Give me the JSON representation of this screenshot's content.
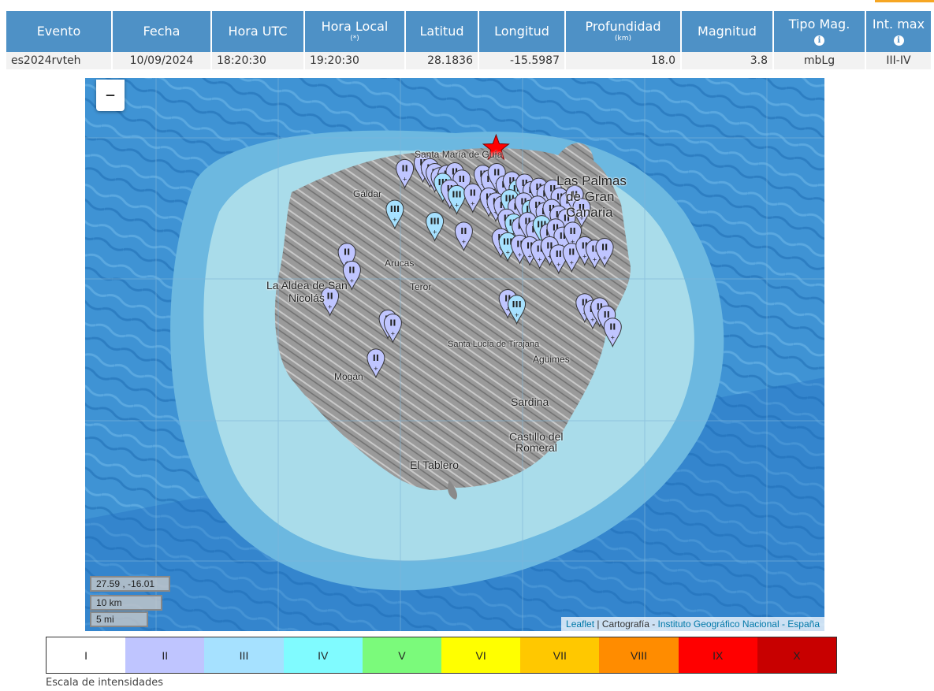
{
  "table": {
    "headers": {
      "evento": "Evento",
      "fecha": "Fecha",
      "hora_utc": "Hora UTC",
      "hora_local": "Hora Local",
      "hora_local_sub": "(*)",
      "latitud": "Latitud",
      "longitud": "Longitud",
      "profundidad": "Profundidad",
      "profundidad_sub": "(km)",
      "magnitud": "Magnitud",
      "tipo_mag": "Tipo Mag.",
      "int_max": "Int. max",
      "info_icon": "i"
    },
    "row": {
      "evento": "es2024rvteh",
      "fecha": "10/09/2024",
      "hora_utc": "18:20:30",
      "hora_local": "19:20:30",
      "latitud": "28.1836",
      "longitud": "-15.5987",
      "profundidad": "18.0",
      "magnitud": "3.8",
      "tipo_mag": "mbLg",
      "int_max": "III-IV"
    }
  },
  "map": {
    "zoom_out_label": "–",
    "places": {
      "las_palmas_1": "Las Palmas",
      "las_palmas_2": "de Gran",
      "las_palmas_3": "Canaria",
      "aldea_1": "La Aldea de San",
      "aldea_2": "Nicolás",
      "sardina": "Sardina",
      "castillo_1": "Castillo del",
      "castillo_2": "Romeral",
      "tablero": "El Tablero",
      "mogan": "Mogán",
      "aguimes": "Agüimes",
      "santa_lucia": "Santa Lucía de Tirajana",
      "arucas": "Arucas",
      "teror": "Teror",
      "galdar": "Gáldar",
      "guia": "Santa María de Guía"
    },
    "coords_readout": "27.59 , -16.01",
    "scale_km": "10 km",
    "scale_mi": "5 mi",
    "attribution": {
      "leaflet": "Leaflet",
      "sep1": " | Cartografía - ",
      "ign": "Instituto Geográfico Nacional",
      "sep2": " - ",
      "espana": "España"
    },
    "epicenter_icon": "star-icon",
    "marker_icon": "map-pin-icon",
    "colors": {
      "ocean": "#3f93d4",
      "shelf": "#a9dcea",
      "intensity_II": "#bfc5ff",
      "intensity_III": "#a6e1ff",
      "epicenter": "#ff0000"
    },
    "markers": [
      {
        "lon": -15.69,
        "lat": 28.135,
        "i": "II"
      },
      {
        "lon": -15.672,
        "lat": 28.142,
        "i": "II"
      },
      {
        "lon": -15.665,
        "lat": 28.136,
        "i": "II"
      },
      {
        "lon": -15.66,
        "lat": 28.13,
        "i": "II"
      },
      {
        "lon": -15.655,
        "lat": 28.125,
        "i": "II"
      },
      {
        "lon": -15.648,
        "lat": 28.128,
        "i": "II"
      },
      {
        "lon": -15.64,
        "lat": 28.131,
        "i": "II"
      },
      {
        "lon": -15.633,
        "lat": 28.122,
        "i": "II"
      },
      {
        "lon": -15.652,
        "lat": 28.118,
        "i": "III"
      },
      {
        "lon": -15.645,
        "lat": 28.11,
        "i": "II"
      },
      {
        "lon": -15.638,
        "lat": 28.103,
        "i": "III"
      },
      {
        "lon": -15.622,
        "lat": 28.105,
        "i": "II"
      },
      {
        "lon": -15.612,
        "lat": 28.128,
        "i": "II"
      },
      {
        "lon": -15.605,
        "lat": 28.122,
        "i": "II"
      },
      {
        "lon": -15.598,
        "lat": 28.13,
        "i": "II"
      },
      {
        "lon": -15.59,
        "lat": 28.115,
        "i": "II"
      },
      {
        "lon": -15.583,
        "lat": 28.12,
        "i": "II"
      },
      {
        "lon": -15.577,
        "lat": 28.11,
        "i": "III"
      },
      {
        "lon": -15.57,
        "lat": 28.117,
        "i": "II"
      },
      {
        "lon": -15.563,
        "lat": 28.108,
        "i": "II"
      },
      {
        "lon": -15.556,
        "lat": 28.112,
        "i": "II"
      },
      {
        "lon": -15.549,
        "lat": 28.104,
        "i": "II"
      },
      {
        "lon": -15.542,
        "lat": 28.11,
        "i": "II"
      },
      {
        "lon": -15.535,
        "lat": 28.1,
        "i": "II"
      },
      {
        "lon": -15.526,
        "lat": 28.095,
        "i": "II"
      },
      {
        "lon": -15.52,
        "lat": 28.103,
        "i": "II"
      },
      {
        "lon": -15.513,
        "lat": 28.087,
        "i": "II"
      },
      {
        "lon": -15.606,
        "lat": 28.1,
        "i": "II"
      },
      {
        "lon": -15.599,
        "lat": 28.094,
        "i": "II"
      },
      {
        "lon": -15.592,
        "lat": 28.09,
        "i": "II"
      },
      {
        "lon": -15.585,
        "lat": 28.098,
        "i": "III"
      },
      {
        "lon": -15.578,
        "lat": 28.088,
        "i": "II"
      },
      {
        "lon": -15.571,
        "lat": 28.094,
        "i": "II"
      },
      {
        "lon": -15.564,
        "lat": 28.085,
        "i": "III"
      },
      {
        "lon": -15.557,
        "lat": 28.09,
        "i": "II"
      },
      {
        "lon": -15.55,
        "lat": 28.082,
        "i": "II"
      },
      {
        "lon": -15.543,
        "lat": 28.086,
        "i": "II"
      },
      {
        "lon": -15.536,
        "lat": 28.078,
        "i": "II"
      },
      {
        "lon": -15.528,
        "lat": 28.074,
        "i": "II"
      },
      {
        "lon": -15.588,
        "lat": 28.074,
        "i": "II"
      },
      {
        "lon": -15.581,
        "lat": 28.068,
        "i": "III"
      },
      {
        "lon": -15.574,
        "lat": 28.064,
        "i": "II"
      },
      {
        "lon": -15.567,
        "lat": 28.07,
        "i": "II"
      },
      {
        "lon": -15.56,
        "lat": 28.06,
        "i": "II"
      },
      {
        "lon": -15.553,
        "lat": 28.066,
        "i": "III"
      },
      {
        "lon": -15.546,
        "lat": 28.056,
        "i": "II"
      },
      {
        "lon": -15.539,
        "lat": 28.062,
        "i": "II"
      },
      {
        "lon": -15.532,
        "lat": 28.052,
        "i": "II"
      },
      {
        "lon": -15.522,
        "lat": 28.058,
        "i": "II"
      },
      {
        "lon": -15.7,
        "lat": 28.085,
        "i": "III"
      },
      {
        "lon": -15.66,
        "lat": 28.07,
        "i": "III"
      },
      {
        "lon": -15.631,
        "lat": 28.058,
        "i": "II"
      },
      {
        "lon": -15.594,
        "lat": 28.05,
        "i": "II"
      },
      {
        "lon": -15.587,
        "lat": 28.045,
        "i": "III"
      },
      {
        "lon": -15.575,
        "lat": 28.042,
        "i": "II"
      },
      {
        "lon": -15.565,
        "lat": 28.04,
        "i": "II"
      },
      {
        "lon": -15.555,
        "lat": 28.036,
        "i": "II"
      },
      {
        "lon": -15.545,
        "lat": 28.04,
        "i": "II"
      },
      {
        "lon": -15.536,
        "lat": 28.03,
        "i": "II"
      },
      {
        "lon": -15.523,
        "lat": 28.032,
        "i": "II"
      },
      {
        "lon": -15.51,
        "lat": 28.04,
        "i": "II"
      },
      {
        "lon": -15.5,
        "lat": 28.036,
        "i": "II"
      },
      {
        "lon": -15.49,
        "lat": 28.038,
        "i": "II"
      },
      {
        "lon": -15.748,
        "lat": 28.032,
        "i": "II"
      },
      {
        "lon": -15.743,
        "lat": 28.01,
        "i": "II"
      },
      {
        "lon": -15.765,
        "lat": 27.978,
        "i": "II"
      },
      {
        "lon": -15.707,
        "lat": 27.95,
        "i": "II"
      },
      {
        "lon": -15.702,
        "lat": 27.945,
        "i": "II"
      },
      {
        "lon": -15.719,
        "lat": 27.902,
        "i": "II"
      },
      {
        "lon": -15.587,
        "lat": 27.975,
        "i": "II"
      },
      {
        "lon": -15.578,
        "lat": 27.968,
        "i": "III"
      },
      {
        "lon": -15.51,
        "lat": 27.97,
        "i": "II"
      },
      {
        "lon": -15.502,
        "lat": 27.962,
        "i": "II"
      },
      {
        "lon": -15.495,
        "lat": 27.965,
        "i": "II"
      },
      {
        "lon": -15.488,
        "lat": 27.955,
        "i": "II"
      },
      {
        "lon": -15.482,
        "lat": 27.94,
        "i": "II"
      }
    ],
    "epicenter": {
      "lon": -15.5987,
      "lat": 28.1836
    }
  },
  "legend": {
    "items": [
      {
        "label": "I",
        "color": "#ffffff"
      },
      {
        "label": "II",
        "color": "#bfc5ff"
      },
      {
        "label": "III",
        "color": "#a6e1ff"
      },
      {
        "label": "IV",
        "color": "#80fbff"
      },
      {
        "label": "V",
        "color": "#7bfa7b"
      },
      {
        "label": "VI",
        "color": "#ffff00"
      },
      {
        "label": "VII",
        "color": "#ffc800"
      },
      {
        "label": "VIII",
        "color": "#ff8c00"
      },
      {
        "label": "IX",
        "color": "#ff0000"
      },
      {
        "label": "X",
        "color": "#c80000"
      }
    ],
    "caption": "Escala de intensidades"
  }
}
